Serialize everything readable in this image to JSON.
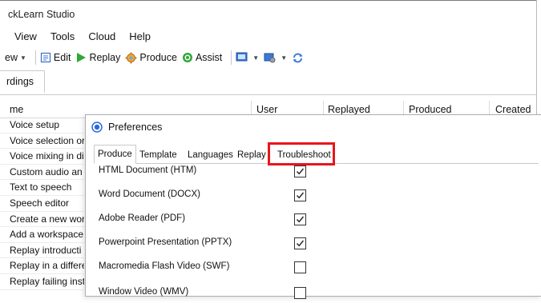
{
  "app": {
    "title": "ckLearn Studio"
  },
  "menu": [
    "View",
    "Tools",
    "Cloud",
    "Help"
  ],
  "toolbar": {
    "view_label": "ew",
    "edit_label": "Edit",
    "replay_label": "Replay",
    "produce_label": "Produce",
    "assist_label": "Assist"
  },
  "tabs": {
    "recordings_label": "rdings"
  },
  "grid": {
    "columns": [
      "me",
      "User",
      "Replayed",
      "Produced",
      "Created"
    ],
    "rows": [
      "Voice setup",
      "Voice selection or",
      "Voice mixing in di",
      "Custom audio an",
      "Text to speech",
      "Speech editor",
      "Create a new wor",
      "Add a workspace",
      "Replay introducti",
      "Replay in a differe",
      "Replay failing inst"
    ]
  },
  "dialog": {
    "title": "Preferences",
    "tabs": [
      "Produce",
      "Template",
      "Languages",
      "Replay",
      "Troubleshoot"
    ],
    "active_tab": "Produce",
    "highlighted_tab": "Troubleshoot",
    "highlight_color": "#e8151c",
    "options": [
      {
        "label": "HTML Document (HTM)",
        "checked": true
      },
      {
        "label": "Word Document (DOCX)",
        "checked": true
      },
      {
        "label": "Adobe Reader (PDF)",
        "checked": true
      },
      {
        "label": "Powerpoint Presentation (PPTX)",
        "checked": true
      },
      {
        "label": "Macromedia Flash Video (SWF)",
        "checked": false
      },
      {
        "label": "Window Video (WMV)",
        "checked": false
      }
    ]
  }
}
